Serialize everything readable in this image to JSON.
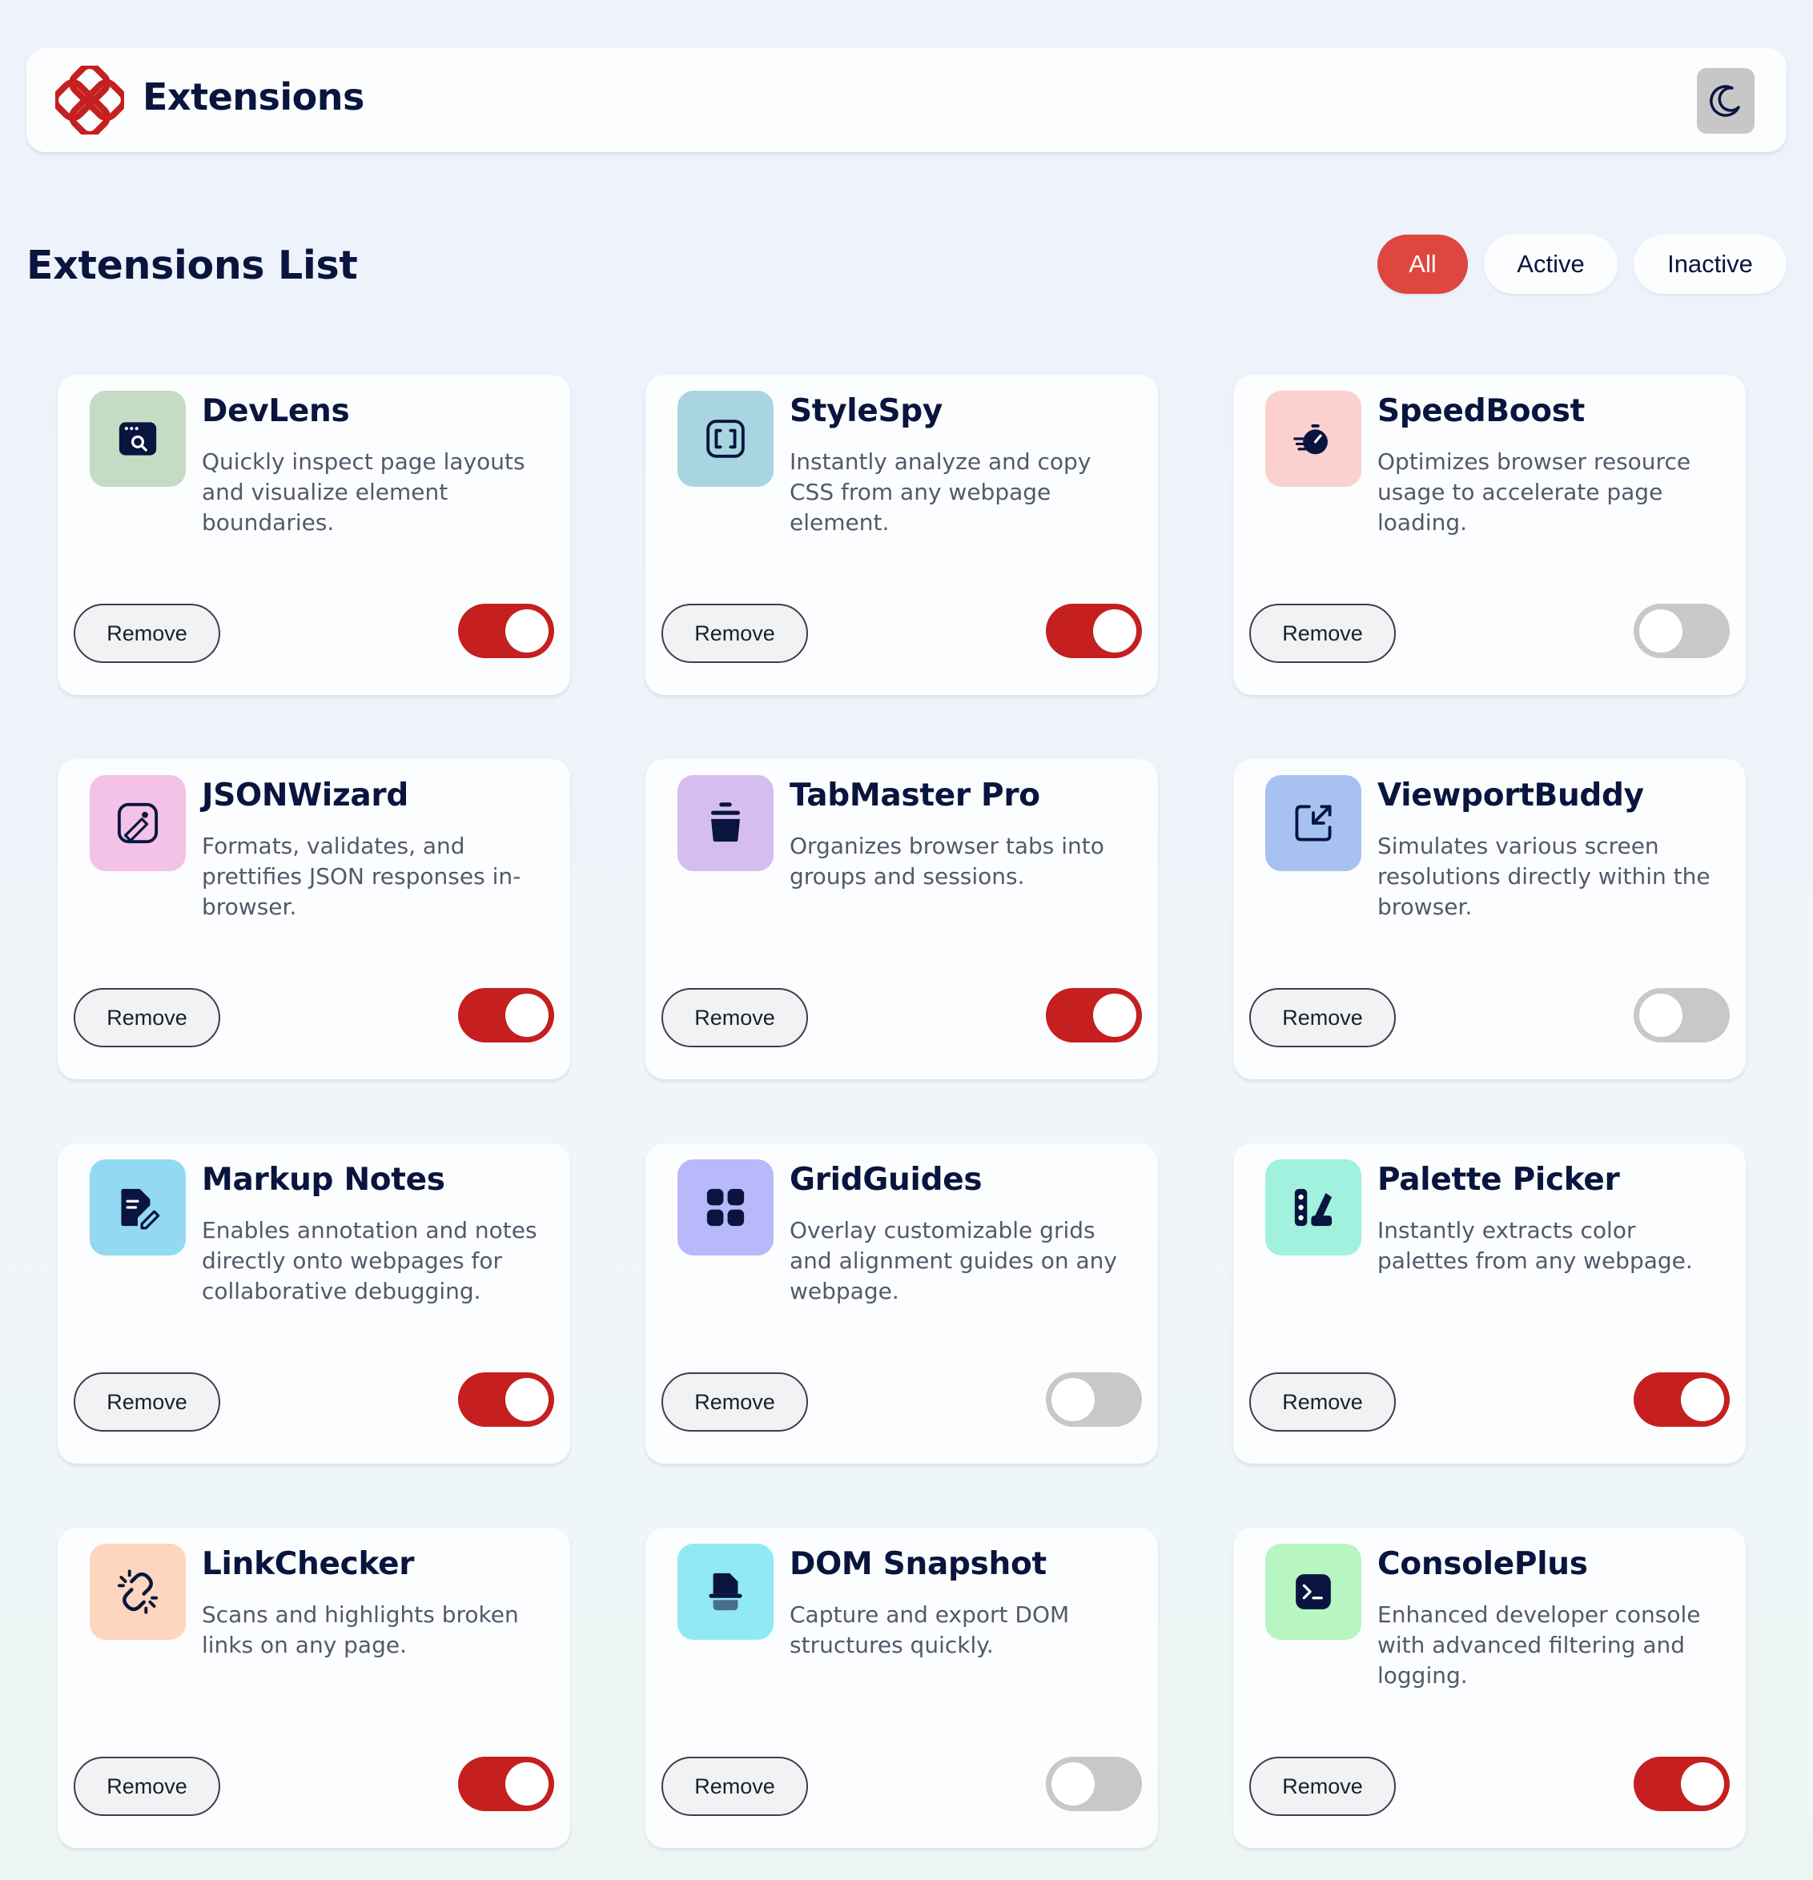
{
  "header": {
    "title": "Extensions",
    "logo_icon": "extensions-logo-icon",
    "theme_icon": "moon-icon",
    "accent_color": "#c51f1f"
  },
  "list": {
    "title": "Extensions List",
    "filters": [
      "All",
      "Active",
      "Inactive"
    ],
    "selected_filter": "All"
  },
  "remove_label": "Remove",
  "extensions": [
    {
      "name": "DevLens",
      "description": "Quickly inspect page layouts and visualize element boundaries.",
      "active": true,
      "icon": "browser-search-icon",
      "icon_bg": "#c4dcc4"
    },
    {
      "name": "StyleSpy",
      "description": "Instantly analyze and copy CSS from any webpage element.",
      "active": true,
      "icon": "brackets-icon",
      "icon_bg": "#a9d5e0"
    },
    {
      "name": "SpeedBoost",
      "description": "Optimizes browser resource usage to accelerate page loading.",
      "active": false,
      "icon": "stopwatch-icon",
      "icon_bg": "#fdd0d0"
    },
    {
      "name": "JSONWizard",
      "description": "Formats, validates, and prettifies JSON responses in-browser.",
      "active": true,
      "icon": "image-edit-icon",
      "icon_bg": "#f4c2e7"
    },
    {
      "name": "TabMaster Pro",
      "description": "Organizes browser tabs into groups and sessions.",
      "active": true,
      "icon": "jar-icon",
      "icon_bg": "#d6bdf0"
    },
    {
      "name": "ViewportBuddy",
      "description": "Simulates various screen resolutions directly within the browser.",
      "active": false,
      "icon": "resize-icon",
      "icon_bg": "#a7c2f2"
    },
    {
      "name": "Markup Notes",
      "description": "Enables annotation and notes directly onto webpages for collaborative debugging.",
      "active": true,
      "icon": "note-edit-icon",
      "icon_bg": "#93d9f2"
    },
    {
      "name": "GridGuides",
      "description": "Overlay customizable grids and alignment guides on any webpage.",
      "active": false,
      "icon": "grid-icon",
      "icon_bg": "#b8b8fb"
    },
    {
      "name": "Palette Picker",
      "description": "Instantly extracts color palettes from any webpage.",
      "active": true,
      "icon": "palette-icon",
      "icon_bg": "#a0f2df"
    },
    {
      "name": "LinkChecker",
      "description": "Scans and highlights broken links on any page.",
      "active": true,
      "icon": "broken-link-icon",
      "icon_bg": "#fdd6bd"
    },
    {
      "name": "DOM Snapshot",
      "description": "Capture and export DOM structures quickly.",
      "active": false,
      "icon": "snapshot-icon",
      "icon_bg": "#91eaf3"
    },
    {
      "name": "ConsolePlus",
      "description": "Enhanced developer console with advanced filtering and logging.",
      "active": true,
      "icon": "terminal-icon",
      "icon_bg": "#b7f5c2"
    }
  ]
}
